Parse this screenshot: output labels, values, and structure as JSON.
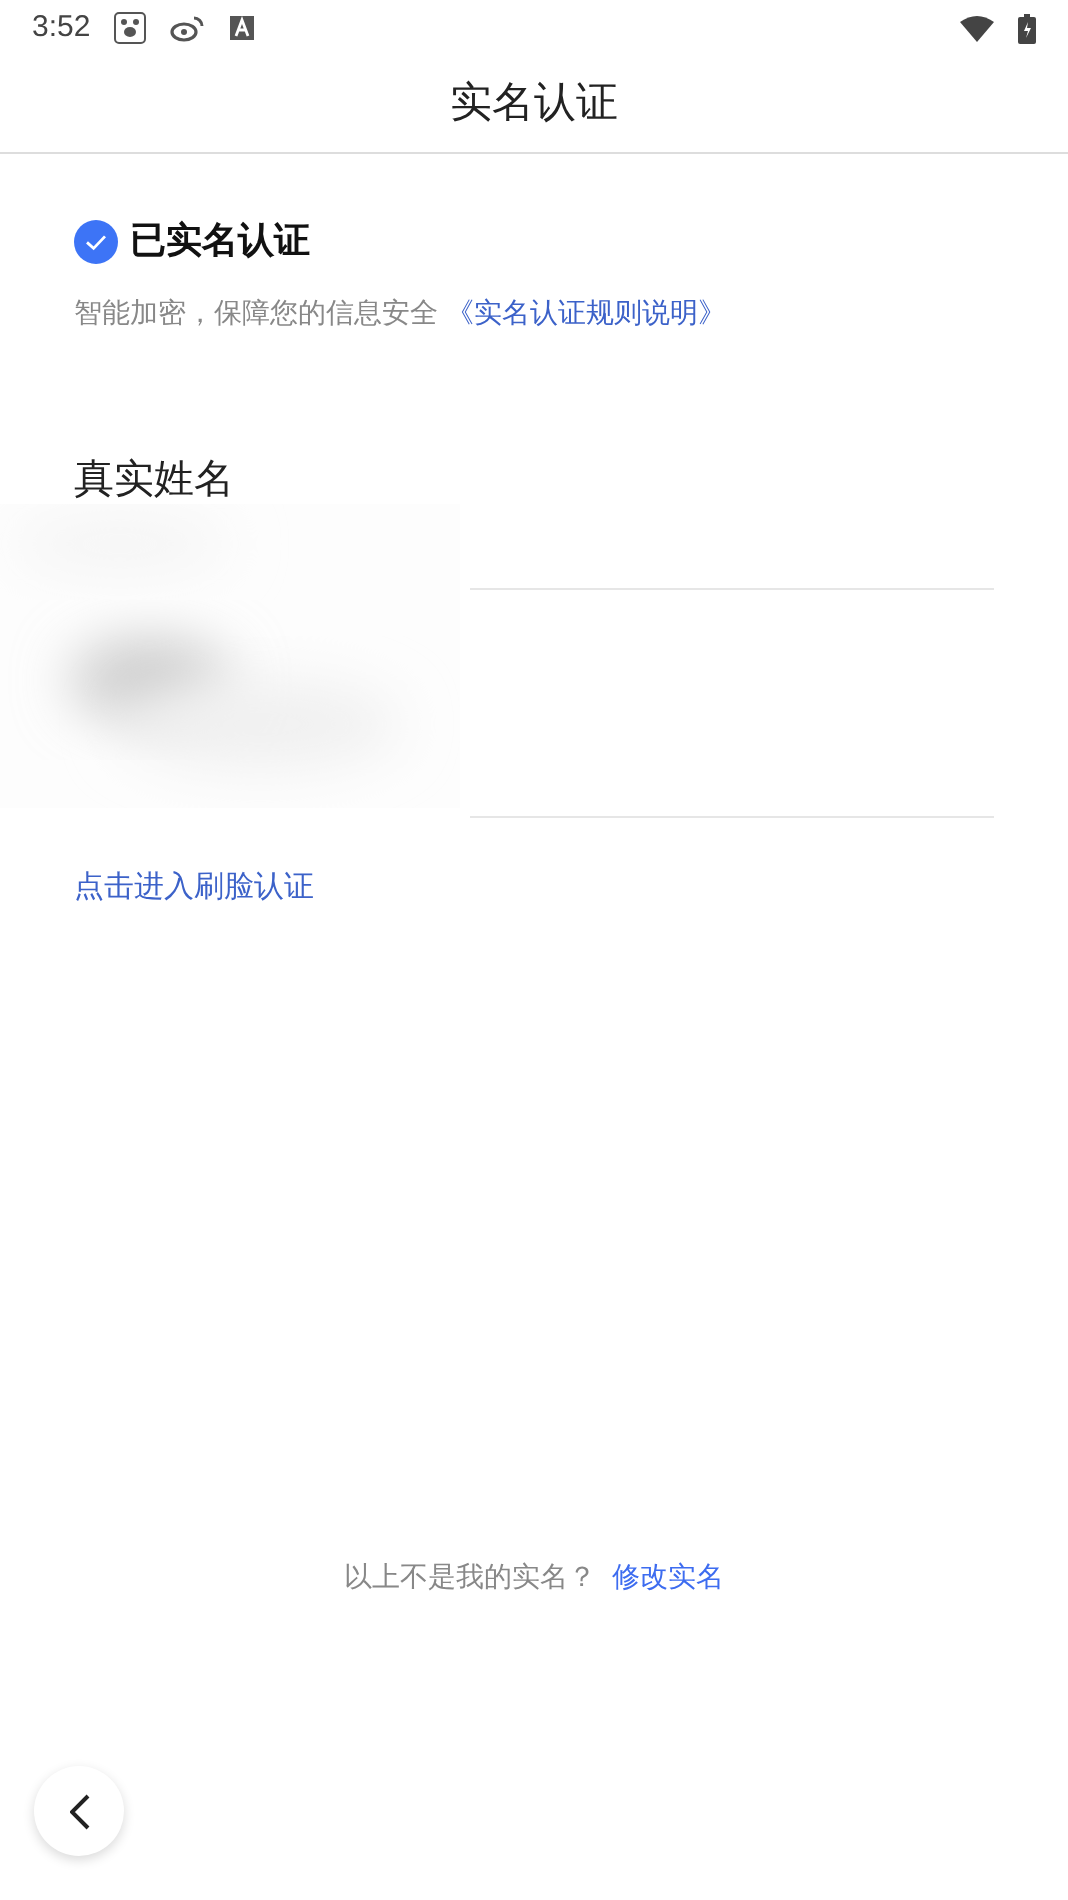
{
  "status_bar": {
    "time": "3:52"
  },
  "header": {
    "title": "实名认证"
  },
  "verification": {
    "verified": true,
    "title": "已实名认证",
    "note": "智能加密，保障您的信息安全",
    "rules_link": "《实名认证规则说明》"
  },
  "fields": [
    {
      "label": "真实姓名"
    }
  ],
  "face_link": "点击进入刷脸认证",
  "footer": {
    "question": "以上不是我的实名？",
    "action": "修改实名"
  }
}
